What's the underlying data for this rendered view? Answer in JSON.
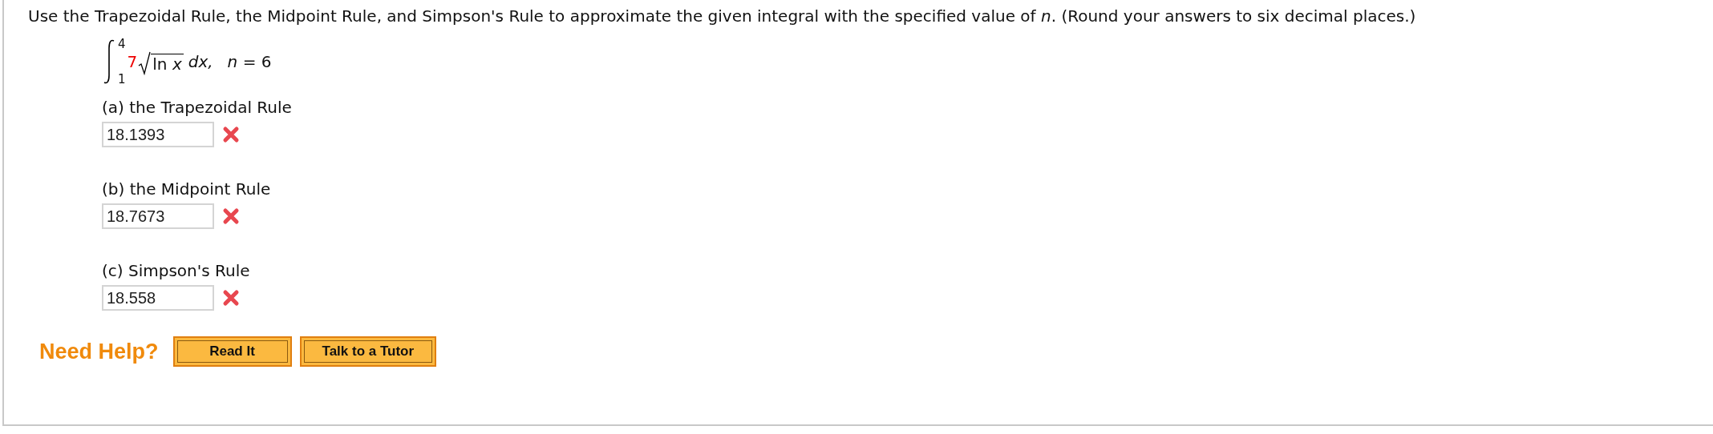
{
  "instructions": "Use the Trapezoidal Rule, the Midpoint Rule, and Simpson's Rule to approximate the given integral with the specified value of *n*. (Round your answers to six decimal places.)",
  "integral": {
    "upper": "4",
    "lower": "1",
    "coefficient": "7",
    "radicand": "ln *x*",
    "differential": "dx,",
    "parameter": "*n* = 6"
  },
  "parts": [
    {
      "label": "(a) the Trapezoidal Rule",
      "value": "18.1393",
      "correct": false
    },
    {
      "label": "(b) the Midpoint Rule",
      "value": "18.7673",
      "correct": false
    },
    {
      "label": "(c) Simpson's Rule",
      "value": "18.558",
      "correct": false
    }
  ],
  "help": {
    "label": "Need Help?",
    "buttons": [
      "Read It",
      "Talk to a Tutor"
    ]
  }
}
